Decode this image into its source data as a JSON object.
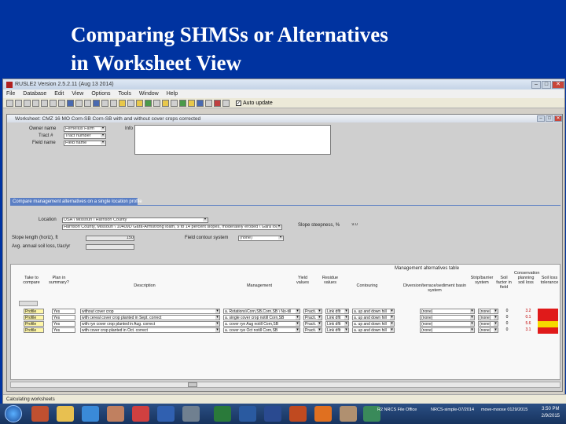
{
  "slide": {
    "title": "Comparing SHMSs or Alternatives\nin Worksheet View"
  },
  "app": {
    "title": "RUSLE2 Version 2.5.2.11 (Aug 13 2014)",
    "menu": [
      "File",
      "Database",
      "Edit",
      "View",
      "Options",
      "Tools",
      "Window",
      "Help"
    ],
    "toolbar_checkbox": "Auto update"
  },
  "worksheet": {
    "title": "Worksheet: CMZ 16 MO Corn-SB Corn-SB with and without cover crops corrected",
    "owner_label": "Owner name",
    "owner_value": "Fernelius Farm",
    "tract_label": "Tract #",
    "tract_value": "Tract number",
    "field_label": "Field name",
    "field_value": "Field name",
    "info_label": "Info",
    "tab_label": "Compare management alternatives on a single location profile",
    "location_label": "Location",
    "location_value": "USA \\ Missouri \\ Harrison County",
    "soil_value": "Harrison County, Missouri \\ 10409D Gara-Armstrong loam, 9 to 14 percent slopes, moderately eroded \\ Gara loam 65%",
    "slope_label": "Slope steepness, %",
    "slope_value": "9.0",
    "length_label": "Slope length (horiz), ft",
    "length_value": "150",
    "contour_label": "Field contour system",
    "contour_value": "(none)",
    "avg_label": "Avg. annual soil loss, t/ac/yr",
    "alt_table_title": "Management alternatives table",
    "headers": {
      "compare": "Take to compare",
      "plan": "Plan in summary?",
      "description": "Description",
      "management": "Management",
      "vegetation": "Yield values",
      "residue": "Residue values",
      "contouring": "Contouring",
      "diversion": "Diversion/terrace/sediment basin system",
      "strip": "Strip/barrier system",
      "factor": "Soil factor in field",
      "cons": "Conservation planning soil loss",
      "tolerance": "Soil loss tolerance"
    },
    "rows": [
      {
        "sel": "Profile",
        "plan": "Yes",
        "desc": "without cover crop",
        "mgmt": "a. Rotations\\Corn,SB,Corn,SB \\ No-till",
        "veg": "Practi.",
        "res": "Link dflt",
        "cont": "a. up and down hill",
        "div": "(none)",
        "strip": "(none)",
        "f": "0",
        "cons": "3.2",
        "tol": "red"
      },
      {
        "sel": "Profile",
        "plan": "Yes",
        "desc": "with cereal cover crop planted in Sept. correct",
        "mgmt": "a. single cover crop notill Corn,SB",
        "veg": "Practi.",
        "res": "Link dflt",
        "cont": "a. up and down hill",
        "div": "(none)",
        "strip": "(none)",
        "f": "0",
        "cons": "0.1",
        "tol": "red"
      },
      {
        "sel": "Profile",
        "plan": "Yes",
        "desc": "with rye cover crop planted in Aug. correct",
        "mgmt": "a. cover rye Aug notill Corn,SB",
        "veg": "Practi.",
        "res": "Link dflt",
        "cont": "a. up and down hill",
        "div": "(none)",
        "strip": "(none)",
        "f": "0",
        "cons": "5.6",
        "tol": "yellow"
      },
      {
        "sel": "Profile",
        "plan": "Yes",
        "desc": "with cover crop planted in Oct. correct",
        "mgmt": "a. cover rye Oct notill Corn,SB",
        "veg": "Practi.",
        "res": "Link dflt",
        "cont": "a. up and down hill",
        "div": "(none)",
        "strip": "(none)",
        "f": "0",
        "cons": "3.1",
        "tol": "red"
      }
    ],
    "status": "Calculating worksheets"
  },
  "taskbar": {
    "item1": "R2 NRCS File Office",
    "item2": "NRCS-simple-07/2014",
    "item3": "move-moose 0129/2015",
    "time": "3:50 PM",
    "date": "2/9/2015"
  }
}
